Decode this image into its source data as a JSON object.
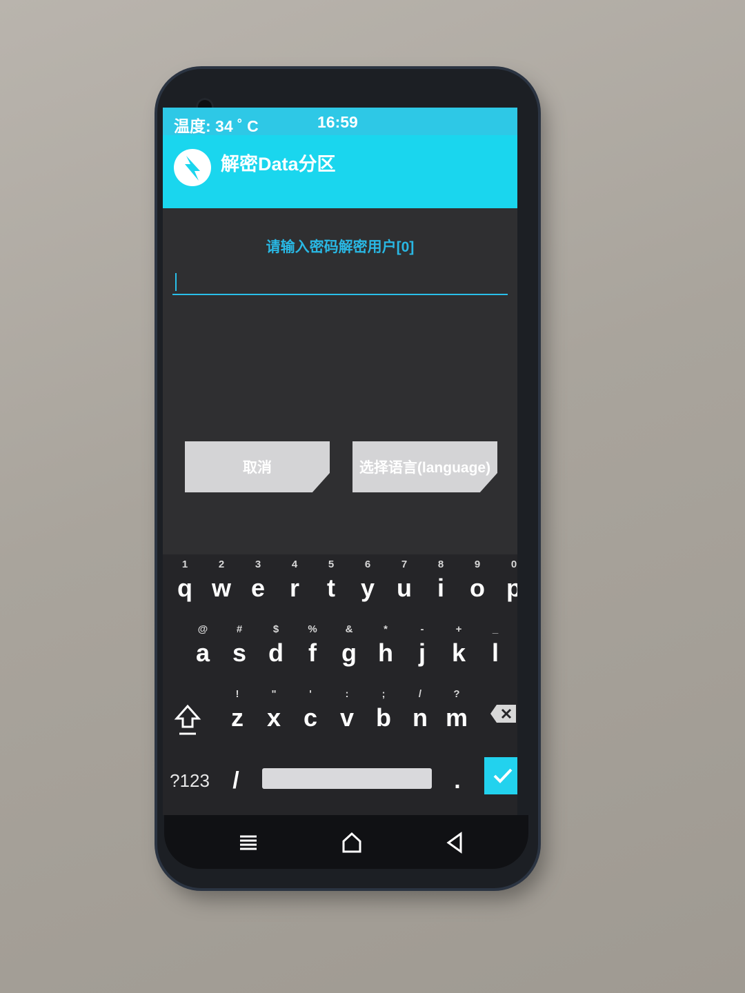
{
  "status_bar": {
    "temperature": "温度: 34 ˚ C",
    "time": "16:59"
  },
  "header": {
    "title": "解密Data分区",
    "icon": "twrp-logo-icon"
  },
  "prompt": "请输入密码解密用户[0]",
  "password_field": {
    "value": ""
  },
  "buttons": {
    "cancel": "取消",
    "language": "选择语言(language)"
  },
  "keyboard": {
    "row1": [
      {
        "hint": "1",
        "key": "q"
      },
      {
        "hint": "2",
        "key": "w"
      },
      {
        "hint": "3",
        "key": "e"
      },
      {
        "hint": "4",
        "key": "r"
      },
      {
        "hint": "5",
        "key": "t"
      },
      {
        "hint": "6",
        "key": "y"
      },
      {
        "hint": "7",
        "key": "u"
      },
      {
        "hint": "8",
        "key": "i"
      },
      {
        "hint": "9",
        "key": "o"
      },
      {
        "hint": "0",
        "key": "p"
      }
    ],
    "row2": [
      {
        "hint": "@",
        "key": "a"
      },
      {
        "hint": "#",
        "key": "s"
      },
      {
        "hint": "$",
        "key": "d"
      },
      {
        "hint": "%",
        "key": "f"
      },
      {
        "hint": "&",
        "key": "g"
      },
      {
        "hint": "*",
        "key": "h"
      },
      {
        "hint": "-",
        "key": "j"
      },
      {
        "hint": "+",
        "key": "k"
      },
      {
        "hint": "_",
        "key": "l"
      }
    ],
    "row3": [
      {
        "hint": "!",
        "key": "z"
      },
      {
        "hint": "\"",
        "key": "x"
      },
      {
        "hint": "'",
        "key": "c"
      },
      {
        "hint": ":",
        "key": "v"
      },
      {
        "hint": ";",
        "key": "b"
      },
      {
        "hint": "/",
        "key": "n"
      },
      {
        "hint": "?",
        "key": "m"
      }
    ],
    "symbols_key": "?123",
    "slash_key": "/",
    "dot_key": "."
  },
  "navigation": {
    "menu_icon": "menu-icon",
    "home_icon": "home-icon",
    "back_icon": "back-icon"
  },
  "colors": {
    "accent": "#1ad6ee",
    "background": "#2f2f31",
    "keyboard": "#252528",
    "button": "#d4d4d6"
  }
}
